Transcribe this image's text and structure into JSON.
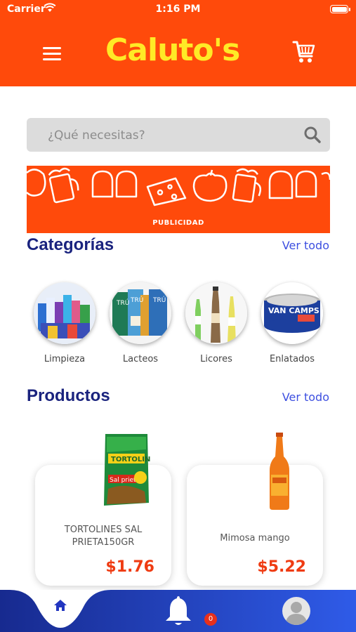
{
  "status_bar": {
    "carrier": "Carrier",
    "time": "1:16 PM"
  },
  "header": {
    "logo": "Caluto's",
    "accent_color": "#ff4a0b",
    "logo_color": "#ffea26"
  },
  "search": {
    "placeholder": "¿Qué necesitas?"
  },
  "banner": {
    "label": "PUBLICIDAD"
  },
  "categories": {
    "title": "Categorías",
    "see_all": "Ver todo",
    "items": [
      {
        "label": "Limpieza"
      },
      {
        "label": "Lacteos"
      },
      {
        "label": "Licores"
      },
      {
        "label": "Enlatados"
      }
    ]
  },
  "products": {
    "title": "Productos",
    "see_all": "Ver todo",
    "items": [
      {
        "name": "TORTOLINES SAL PRIETA150GR",
        "price": "$1.76"
      },
      {
        "name": "Mimosa mango",
        "price": "$5.22"
      }
    ]
  },
  "bottom_nav": {
    "notification_count": "0",
    "nav_color": "#1f35c8"
  }
}
